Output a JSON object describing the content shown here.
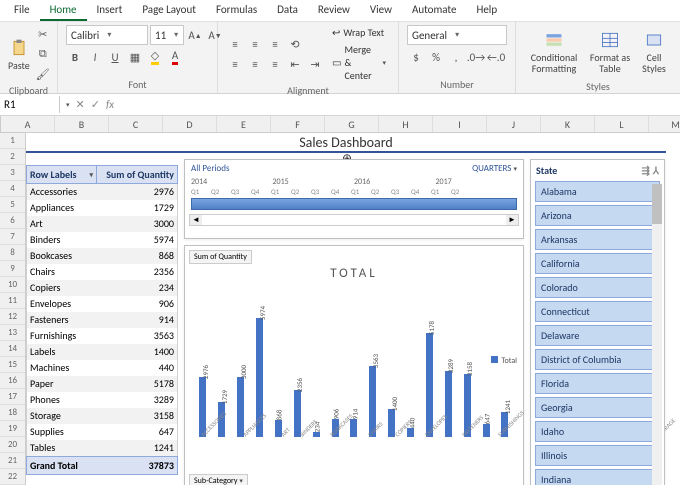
{
  "menu": {
    "tabs": [
      "File",
      "Home",
      "Insert",
      "Page Layout",
      "Formulas",
      "Data",
      "Review",
      "View",
      "Automate",
      "Help"
    ],
    "active": "Home"
  },
  "ribbon": {
    "clipboard": {
      "label": "Clipboard",
      "paste": "Paste"
    },
    "font": {
      "label": "Font",
      "name": "Calibri",
      "size": "11"
    },
    "alignment": {
      "label": "Alignment",
      "wrap": "Wrap Text",
      "merge": "Merge & Center"
    },
    "number": {
      "label": "Number",
      "format": "General"
    },
    "styles": {
      "label": "Styles",
      "cond": "Conditional Formatting",
      "fmt": "Format as Table",
      "cell": "Cell Styles"
    }
  },
  "fx": {
    "cell_ref": "R1",
    "formula": ""
  },
  "columns": [
    "A",
    "B",
    "C",
    "D",
    "E",
    "F",
    "G",
    "H",
    "I",
    "J",
    "K",
    "L",
    "M"
  ],
  "row_start": 1,
  "row_count": 22,
  "title": "Sales Dashboard",
  "pivot": {
    "header1": "Row Labels",
    "header2": "Sum of Quantity",
    "rows": [
      {
        "label": "Accessories",
        "value": 2976
      },
      {
        "label": "Appliances",
        "value": 1729
      },
      {
        "label": "Art",
        "value": 3000
      },
      {
        "label": "Binders",
        "value": 5974
      },
      {
        "label": "Bookcases",
        "value": 868
      },
      {
        "label": "Chairs",
        "value": 2356
      },
      {
        "label": "Copiers",
        "value": 234
      },
      {
        "label": "Envelopes",
        "value": 906
      },
      {
        "label": "Fasteners",
        "value": 914
      },
      {
        "label": "Furnishings",
        "value": 3563
      },
      {
        "label": "Labels",
        "value": 1400
      },
      {
        "label": "Machines",
        "value": 440
      },
      {
        "label": "Paper",
        "value": 5178
      },
      {
        "label": "Phones",
        "value": 3289
      },
      {
        "label": "Storage",
        "value": 3158
      },
      {
        "label": "Supplies",
        "value": 647
      },
      {
        "label": "Tables",
        "value": 1241
      }
    ],
    "total_label": "Grand Total",
    "total_value": 37873
  },
  "timeline": {
    "title": "All Periods",
    "level_label": "QUARTERS",
    "years": [
      "2014",
      "2015",
      "2016",
      "2017"
    ],
    "quarters": [
      "Q1",
      "Q2",
      "Q3",
      "Q4",
      "Q1",
      "Q2",
      "Q3",
      "Q4",
      "Q1",
      "Q2",
      "Q3",
      "Q4",
      "Q1",
      "Q2"
    ]
  },
  "chart": {
    "field_button_top": "Sum of Quantity",
    "title": "TOTAL",
    "legend": "Total",
    "field_button_bottom": "Sub-Category"
  },
  "chart_data": {
    "type": "bar",
    "title": "TOTAL",
    "xlabel": "Sub-Category",
    "ylabel": "Sum of Quantity",
    "categories": [
      "ACCESSORIES",
      "APPLIANCES",
      "ART",
      "BINDERS",
      "BOOKCASES",
      "CHAIRS",
      "COPIERS",
      "ENVELOPES",
      "FASTENERS",
      "FURNISHINGS",
      "LABELS",
      "MACHINES",
      "PAPER",
      "PHONES",
      "STORAGE",
      "SUPPLIES",
      "TABLES"
    ],
    "values": [
      2976,
      1729,
      3000,
      5974,
      868,
      2356,
      234,
      906,
      914,
      3563,
      1400,
      440,
      5178,
      3289,
      3158,
      647,
      1241
    ],
    "series": [
      {
        "name": "Total",
        "values": [
          2976,
          1729,
          3000,
          5974,
          868,
          2356,
          234,
          906,
          914,
          3563,
          1400,
          440,
          5178,
          3289,
          3158,
          647,
          1241
        ]
      }
    ],
    "ylim": [
      0,
      6000
    ]
  },
  "slicer": {
    "title": "State",
    "items": [
      "Alabama",
      "Arizona",
      "Arkansas",
      "California",
      "Colorado",
      "Connecticut",
      "Delaware",
      "District of Columbia",
      "Florida",
      "Georgia",
      "Idaho",
      "Illinois",
      "Indiana"
    ]
  }
}
